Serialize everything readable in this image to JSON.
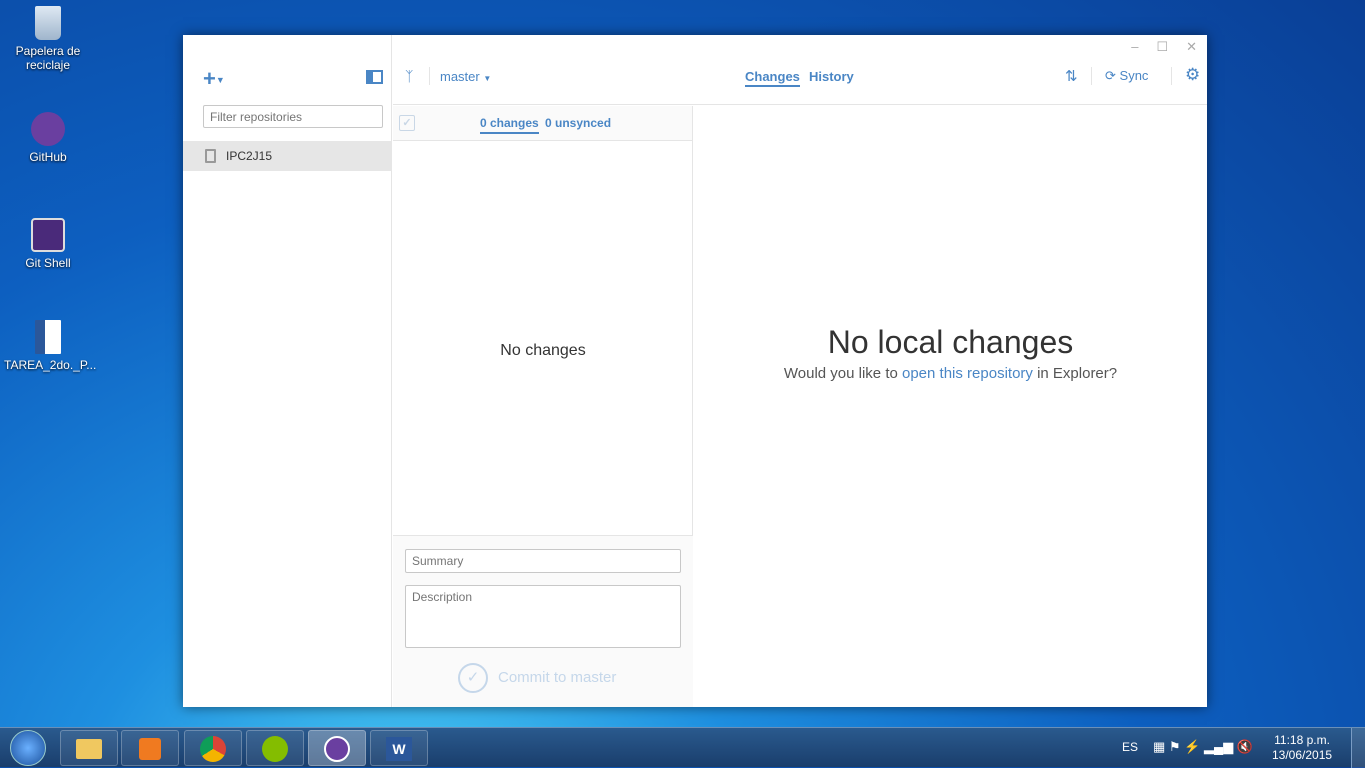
{
  "desktop": {
    "icons": [
      {
        "label": "Papelera de reciclaje"
      },
      {
        "label": "GitHub"
      },
      {
        "label": "Git Shell"
      },
      {
        "label": "TAREA_2do._P..."
      }
    ]
  },
  "app": {
    "sidebar": {
      "filter_placeholder": "Filter repositories",
      "repos": [
        {
          "name": "IPC2J15"
        }
      ]
    },
    "toolbar": {
      "branch": "master",
      "tabs": [
        {
          "label": "Changes"
        },
        {
          "label": "History"
        }
      ],
      "sync": "Sync"
    },
    "changes": {
      "changes_tab": "0 changes",
      "unsynced_tab": "0 unsynced",
      "empty": "No changes"
    },
    "commit": {
      "summary_placeholder": "Summary",
      "description_placeholder": "Description",
      "button": "Commit to master"
    },
    "main": {
      "title": "No local changes",
      "prefix": "Would you like to ",
      "link": "open this repository",
      "suffix": " in Explorer?"
    }
  },
  "taskbar": {
    "lang": "ES",
    "time": "11:18 p.m.",
    "date": "13/06/2015"
  },
  "colors": {
    "accent": "#4a86c5"
  }
}
